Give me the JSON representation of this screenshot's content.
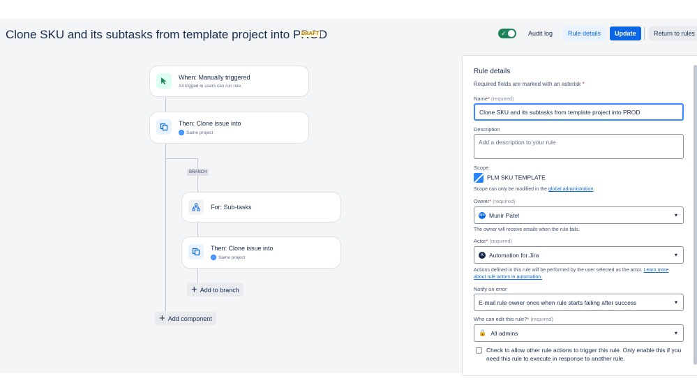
{
  "header": {
    "title": "Clone SKU and its subtasks from template project into PROD",
    "status_badge": "DRAFT",
    "audit_log": "Audit log",
    "rule_details": "Rule details",
    "update": "Update",
    "return_to_rules": "Return to rules"
  },
  "flow": {
    "trigger": {
      "title": "When: Manually triggered",
      "subtitle": "All logged in users can run rule.",
      "icon": "cursor-click-icon"
    },
    "action1": {
      "title": "Then: Clone issue into",
      "subtitle": "Same project",
      "icon": "copy-icon"
    },
    "branch_tag": "BRANCH",
    "branch": {
      "title": "For: Sub-tasks",
      "icon": "hierarchy-icon"
    },
    "action2": {
      "title": "Then: Clone issue into",
      "subtitle": "Same project",
      "icon": "copy-icon"
    },
    "add_to_branch": "Add to branch",
    "add_component": "Add component"
  },
  "panel": {
    "heading": "Rule details",
    "required_note": "Required fields are marked with an asterisk",
    "asterisk": "*",
    "name_label": "Name",
    "required": "(required)",
    "name_value": "Clone SKU and its subtasks from template project into PROD",
    "description_label": "Description",
    "description_placeholder": "Add a description to your rule",
    "scope_label": "Scope",
    "scope_value": "PLM SKU TEMPLATE",
    "scope_help": "Scope can only be modified in the",
    "scope_link": "global administration",
    "scope_help_end": ".",
    "owner_label": "Owner",
    "owner_value": "Munir Patel",
    "owner_help": "The owner will receive emails when the rule fails.",
    "actor_label": "Actor",
    "actor_value": "Automation for Jira",
    "actor_help": "Actions defined in this rule will be performed by the user selected as the actor.",
    "actor_link": "Learn more about rule actors in automation.",
    "notify_label": "Notify on error",
    "notify_value": "E-mail rule owner once when rule starts failing after success",
    "edit_label": "Who can edit this rule?",
    "edit_value": "All admins",
    "checkbox_text": "Check to allow other rule actions to trigger this rule. Only enable this if you need this rule to execute in response to another rule."
  },
  "colors": {
    "accent": "#0c66e4",
    "toggle_on": "#1f845a",
    "draft": "#a06900"
  }
}
